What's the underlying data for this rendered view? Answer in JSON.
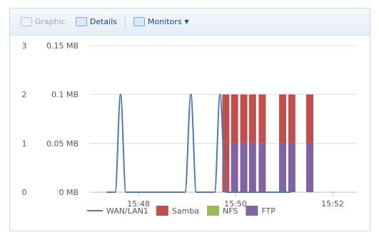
{
  "toolbar": {
    "graphic_label": "Graphic",
    "details_label": "Details",
    "monitors_label": "Monitors"
  },
  "chart_data": {
    "type": "bar",
    "x_ticks": [
      "15:48",
      "15:50",
      "15:52"
    ],
    "y_ticks_left": [
      "3",
      "2",
      "1",
      "0"
    ],
    "y_ticks_right": [
      "0.15 MB",
      "0.1 MB",
      "0.05 MB",
      "0 MB"
    ],
    "ylim": [
      0,
      3
    ],
    "grid": true,
    "legend_position": "bottom",
    "series": [
      {
        "name": "WAN/LAN1",
        "kind": "line",
        "color": "#4f78b5",
        "points": [
          [
            47.34,
            0
          ],
          [
            47.52,
            0
          ],
          [
            47.63,
            2
          ],
          [
            47.74,
            0
          ],
          [
            48.96,
            0
          ],
          [
            49.08,
            2
          ],
          [
            49.19,
            0
          ],
          [
            49.57,
            0
          ],
          [
            49.68,
            2
          ],
          [
            49.8,
            0
          ],
          [
            51.14,
            0
          ]
        ]
      },
      {
        "name": "Samba",
        "kind": "bar",
        "color": "#c0504d"
      },
      {
        "name": "NFS",
        "kind": "bar",
        "color": "#9bbb59"
      },
      {
        "name": "FTP",
        "kind": "bar",
        "color": "#8064a2"
      }
    ],
    "bars": [
      {
        "x": 49.8,
        "segments": [
          {
            "series": "Samba",
            "from": 0,
            "to": 1
          },
          {
            "series": "Samba",
            "from": 1,
            "to": 2
          }
        ]
      },
      {
        "x": 49.98,
        "segments": [
          {
            "series": "FTP",
            "from": 0,
            "to": 1
          },
          {
            "series": "Samba",
            "from": 1,
            "to": 2
          }
        ]
      },
      {
        "x": 50.17,
        "segments": [
          {
            "series": "FTP",
            "from": 0,
            "to": 1
          },
          {
            "series": "Samba",
            "from": 1,
            "to": 2
          }
        ]
      },
      {
        "x": 50.35,
        "segments": [
          {
            "series": "FTP",
            "from": 0,
            "to": 1
          },
          {
            "series": "Samba",
            "from": 1,
            "to": 2
          }
        ]
      },
      {
        "x": 50.55,
        "segments": [
          {
            "series": "FTP",
            "from": 0,
            "to": 1
          },
          {
            "series": "Samba",
            "from": 1,
            "to": 2
          }
        ]
      },
      {
        "x": 50.97,
        "segments": [
          {
            "series": "FTP",
            "from": 0,
            "to": 1
          },
          {
            "series": "Samba",
            "from": 1,
            "to": 2
          }
        ]
      },
      {
        "x": 51.16,
        "segments": [
          {
            "series": "FTP",
            "from": 0,
            "to": 1
          },
          {
            "series": "Samba",
            "from": 1,
            "to": 2
          }
        ]
      },
      {
        "x": 51.53,
        "segments": [
          {
            "series": "FTP",
            "from": 0,
            "to": 1
          },
          {
            "series": "Samba",
            "from": 1,
            "to": 2
          }
        ]
      }
    ]
  }
}
